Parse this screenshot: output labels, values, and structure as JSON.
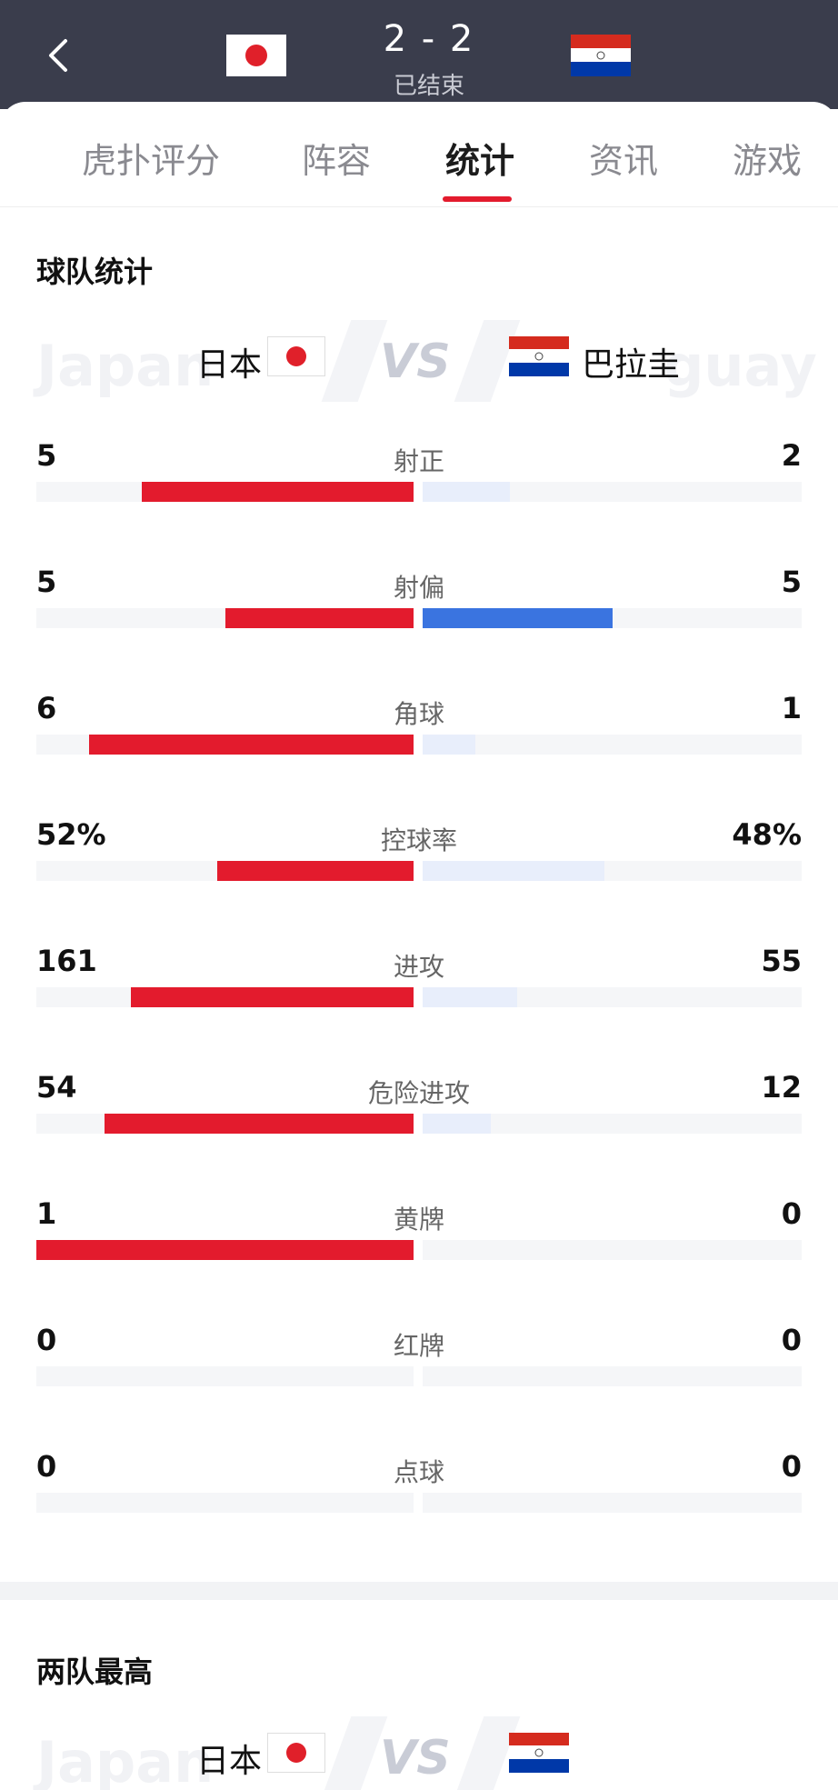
{
  "header": {
    "score": "2 - 2",
    "status": "已结束",
    "home_flag": "japan-flag",
    "away_flag": "paraguay-flag"
  },
  "tabs": [
    {
      "label": "虎扑评分",
      "active": false
    },
    {
      "label": "阵容",
      "active": false
    },
    {
      "label": "统计",
      "active": true
    },
    {
      "label": "资讯",
      "active": false
    },
    {
      "label": "游戏",
      "active": false
    }
  ],
  "team_stats": {
    "title": "球队统计",
    "home_name": "日本",
    "away_name": "巴拉圭",
    "home_ghost": "Japan",
    "away_ghost": "guay",
    "vs": "VS",
    "rows": [
      {
        "label": "射正",
        "home": "5",
        "away": "2",
        "home_frac": 0.72,
        "away_frac": 0.23,
        "away_strong": false
      },
      {
        "label": "射偏",
        "home": "5",
        "away": "5",
        "home_frac": 0.5,
        "away_frac": 0.5,
        "away_strong": true
      },
      {
        "label": "角球",
        "home": "6",
        "away": "1",
        "home_frac": 0.86,
        "away_frac": 0.14,
        "away_strong": false
      },
      {
        "label": "控球率",
        "home": "52%",
        "away": "48%",
        "home_frac": 0.52,
        "away_frac": 0.48,
        "away_strong": false
      },
      {
        "label": "进攻",
        "home": "161",
        "away": "55",
        "home_frac": 0.75,
        "away_frac": 0.25,
        "away_strong": false
      },
      {
        "label": "危险进攻",
        "home": "54",
        "away": "12",
        "home_frac": 0.82,
        "away_frac": 0.18,
        "away_strong": false
      },
      {
        "label": "黄牌",
        "home": "1",
        "away": "0",
        "home_frac": 1.0,
        "away_frac": 0.0,
        "away_strong": false
      },
      {
        "label": "红牌",
        "home": "0",
        "away": "0",
        "home_frac": 0.0,
        "away_frac": 0.0,
        "away_strong": false
      },
      {
        "label": "点球",
        "home": "0",
        "away": "0",
        "home_frac": 0.0,
        "away_frac": 0.0,
        "away_strong": false
      }
    ]
  },
  "top_players": {
    "title": "两队最高",
    "home_name": "日本",
    "vs": "VS",
    "home_ghost": "Japan"
  },
  "colors": {
    "header_bg": "#3a3d4c",
    "accent_red": "#e31b2d",
    "away_blue": "#3a74e0",
    "away_light": "#e8eefb"
  }
}
